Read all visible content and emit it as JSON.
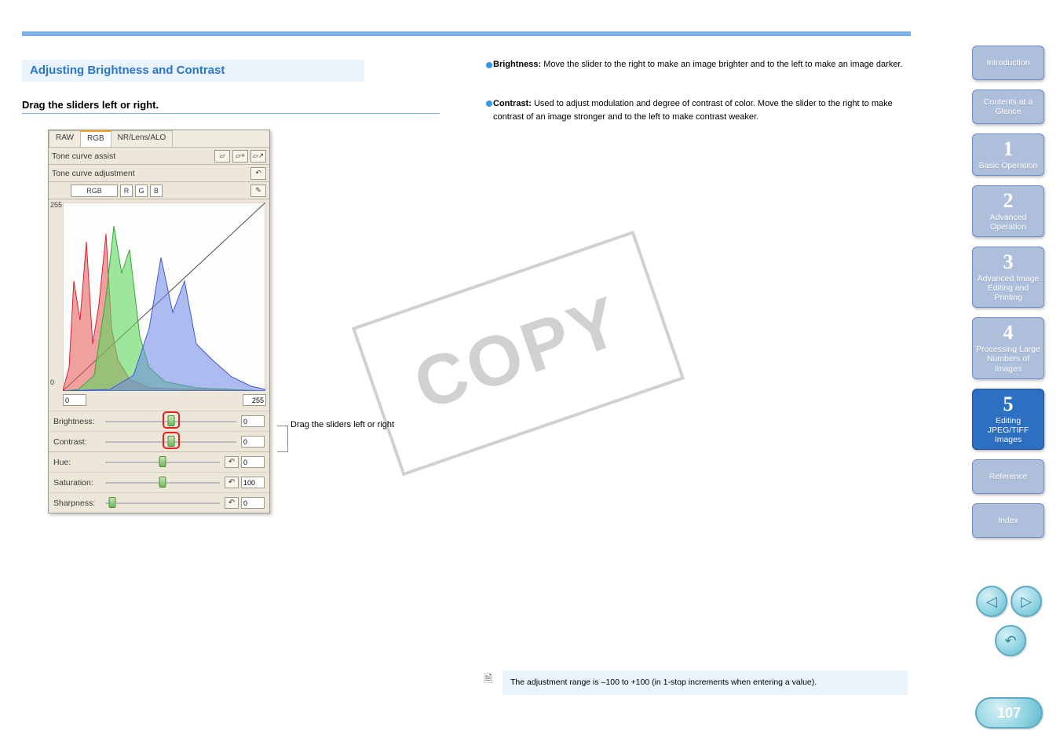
{
  "section_title": "Adjusting Brightness and Contrast",
  "subtitle": "Drag the sliders left or right.",
  "bullets": {
    "brightness": {
      "label": "Brightness:",
      "text": "Move the slider to the right to make an image brighter and to the left to make an image darker."
    },
    "contrast": {
      "label": "Contrast:",
      "text": "Used to adjust modulation and degree of contrast of color. Move the slider to the right to make contrast of an image stronger and to the left to make contrast weaker."
    }
  },
  "panel": {
    "tabs": {
      "raw": "RAW",
      "rgb": "RGB",
      "nr": "NR/Lens/ALO"
    },
    "row_assist": "Tone curve assist",
    "row_adjust": "Tone curve adjustment",
    "channel": {
      "rgb": "RGB",
      "r": "R",
      "g": "G",
      "b": "B"
    },
    "hist": {
      "ymax": "255",
      "ymin": "0",
      "xmin": "0",
      "xmax": "255"
    },
    "sliders": {
      "brightness": {
        "label": "Brightness:",
        "value": "0"
      },
      "contrast": {
        "label": "Contrast:",
        "value": "0"
      },
      "hue": {
        "label": "Hue:",
        "value": "0"
      },
      "saturation": {
        "label": "Saturation:",
        "value": "100"
      },
      "sharpness": {
        "label": "Sharpness:",
        "value": "0"
      }
    }
  },
  "bridge_label": "Drag the sliders left or right",
  "range_note": "The adjustment range is –100 to +100 (in 1-stop increments when entering a value).",
  "stamp": "COPY",
  "sidebar": {
    "intro": "Introduction",
    "contents": "Contents at a Glance",
    "nav1_num": "1",
    "nav1": "Basic Operation",
    "nav2_num": "2",
    "nav2": "Advanced Operation",
    "nav3_num": "3",
    "nav3": "Advanced Image Editing and Printing",
    "nav4_num": "4",
    "nav4": "Processing Large Numbers of Images",
    "nav5_num": "5",
    "nav5": "Editing JPEG/TIFF Images",
    "ref": "Reference",
    "idx": "Index"
  },
  "nav_icons": {
    "prev": "◁",
    "next": "▷",
    "back": "↶"
  },
  "page_number": "107"
}
